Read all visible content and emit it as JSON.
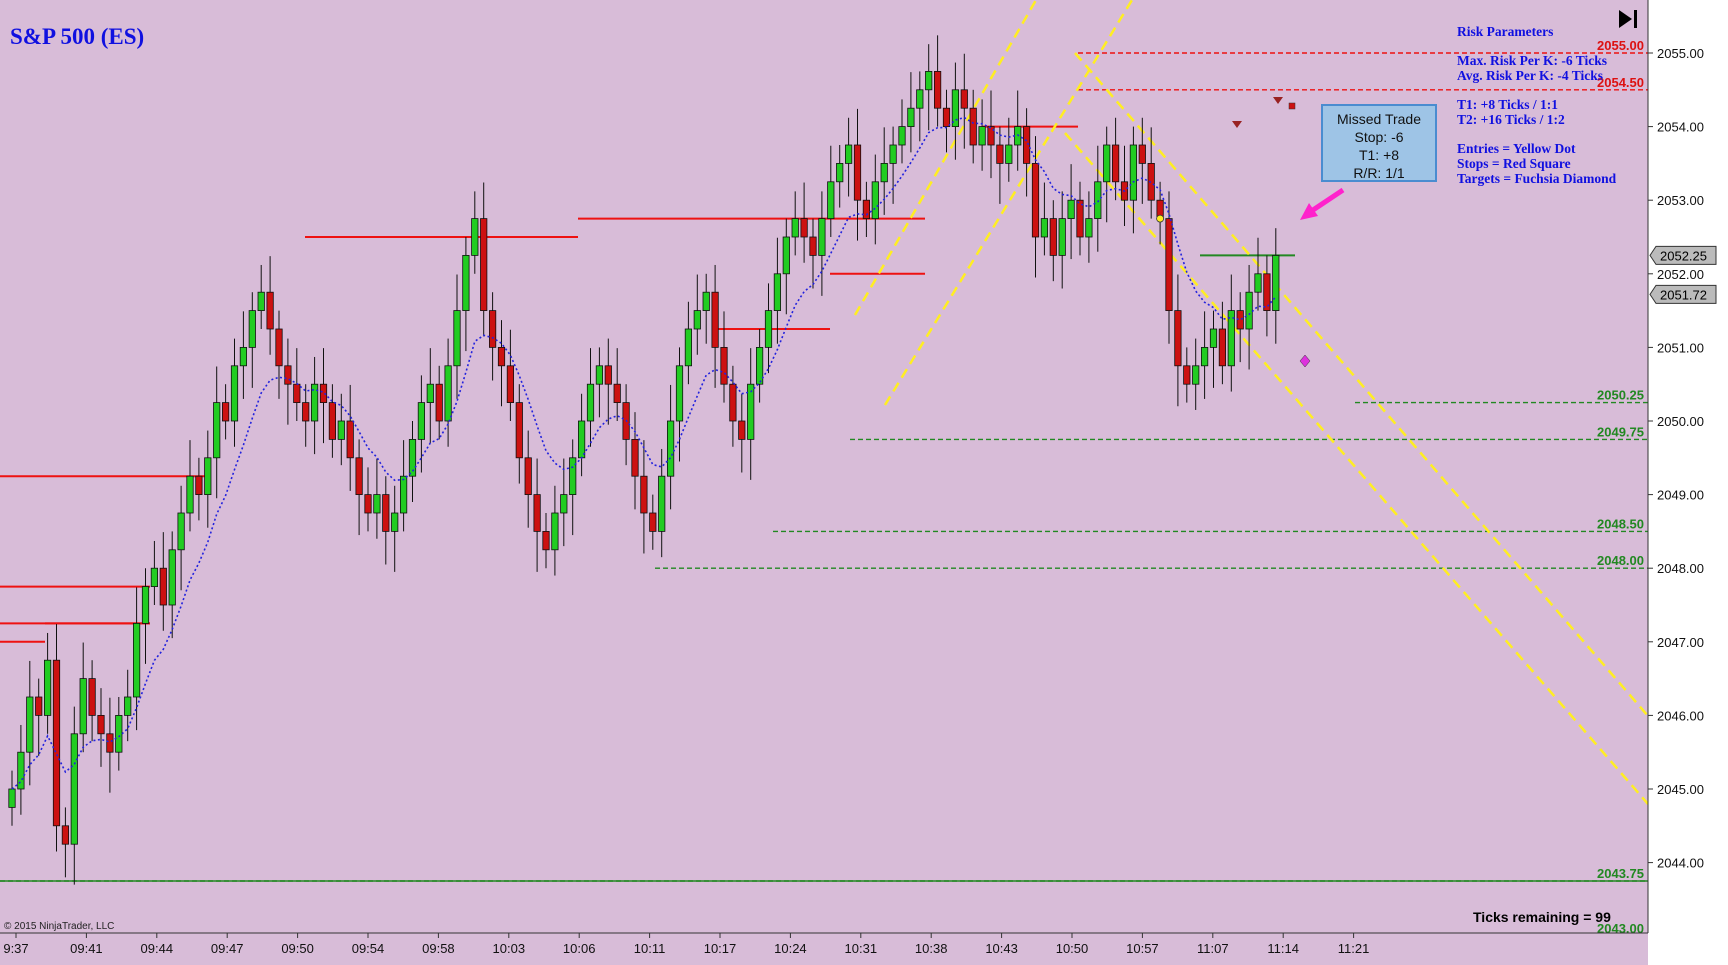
{
  "header": {
    "title": "S&P 500 (ES)"
  },
  "risk_panel": {
    "title": "Risk Parameters",
    "max_risk": "Max. Risk Per K:  -6 Ticks",
    "avg_risk": "Avg. Risk Per K:  -4 Ticks",
    "t1": "T1:  +8 Ticks  /  1:1",
    "t2": "T2:  +16 Ticks  /  1:2",
    "entries": "Entries = Yellow Dot",
    "stops": "Stops = Red Square",
    "targets": "Targets = Fuchsia Diamond"
  },
  "missed_trade": {
    "title": "Missed Trade",
    "stop": "Stop:  -6",
    "t1": "T1:  +8",
    "rr": "R/R:  1/1"
  },
  "footer": {
    "copyright": "© 2015 NinjaTrader, LLC",
    "ticks_remaining": "Ticks remaining = 99"
  },
  "colors": {
    "background": "#d8bcd8",
    "up_candle": "#22cc22",
    "down_candle": "#cc1111",
    "resistance": "#ee1111",
    "support": "#228822",
    "channel": "#ffee22",
    "ma": "#2222dd",
    "title": "#1010e0"
  },
  "icons": {
    "end_button": "skip-to-end-icon",
    "missed_arrow": "arrow-icon"
  },
  "chart_data": {
    "type": "candlestick",
    "instrument": "S&P 500 (ES)",
    "ylim": [
      2043.0,
      2055.5
    ],
    "y_ticks": [
      "2055.00",
      "2054.00",
      "2053.00",
      "2052.00",
      "2051.00",
      "2050.00",
      "2049.00",
      "2048.00",
      "2047.00",
      "2046.00",
      "2045.00",
      "2044.00"
    ],
    "x_ticks": [
      "9:37",
      "09:41",
      "09:44",
      "09:47",
      "09:50",
      "09:54",
      "09:58",
      "10:03",
      "10:06",
      "10:11",
      "10:17",
      "10:24",
      "10:31",
      "10:38",
      "10:43",
      "10:50",
      "10:57",
      "11:07",
      "11:14",
      "11:21"
    ],
    "price_markers": [
      {
        "label": "2052.25",
        "value": 2052.25
      },
      {
        "label": "2051.72",
        "value": 2051.72
      }
    ],
    "level_labels": [
      {
        "label": "2055.00",
        "value": 2055.0,
        "kind": "resistance"
      },
      {
        "label": "2054.50",
        "value": 2054.5,
        "kind": "resistance"
      },
      {
        "label": "2050.25",
        "value": 2050.25,
        "kind": "support"
      },
      {
        "label": "2049.75",
        "value": 2049.75,
        "kind": "support"
      },
      {
        "label": "2048.50",
        "value": 2048.5,
        "kind": "support"
      },
      {
        "label": "2048.00",
        "value": 2048.0,
        "kind": "support"
      },
      {
        "label": "2043.75",
        "value": 2043.75,
        "kind": "support"
      },
      {
        "label": "2043.00",
        "value": 2043.0,
        "kind": "support"
      }
    ],
    "closes": [
      2045.0,
      2045.5,
      2046.25,
      2046.0,
      2046.75,
      2044.5,
      2044.25,
      2045.75,
      2046.5,
      2046.0,
      2045.75,
      2045.5,
      2046.0,
      2046.25,
      2047.25,
      2047.75,
      2048.0,
      2047.5,
      2048.25,
      2048.75,
      2049.25,
      2049.0,
      2049.5,
      2050.25,
      2050.0,
      2050.75,
      2051.0,
      2051.5,
      2051.75,
      2051.25,
      2050.75,
      2050.5,
      2050.25,
      2050.0,
      2050.5,
      2050.25,
      2049.75,
      2050.0,
      2049.5,
      2049.0,
      2048.75,
      2049.0,
      2048.5,
      2048.75,
      2049.25,
      2049.75,
      2050.25,
      2050.5,
      2050.0,
      2050.75,
      2051.5,
      2052.25,
      2052.75,
      2051.5,
      2051.0,
      2050.75,
      2050.25,
      2049.5,
      2049.0,
      2048.5,
      2048.25,
      2048.75,
      2049.0,
      2049.5,
      2050.0,
      2050.5,
      2050.75,
      2050.5,
      2050.25,
      2049.75,
      2049.25,
      2048.75,
      2048.5,
      2049.25,
      2050.0,
      2050.75,
      2051.25,
      2051.5,
      2051.75,
      2051.0,
      2050.5,
      2050.0,
      2049.75,
      2050.5,
      2051.0,
      2051.5,
      2052.0,
      2052.5,
      2052.75,
      2052.5,
      2052.25,
      2052.75,
      2053.25,
      2053.5,
      2053.75,
      2053.0,
      2052.75,
      2053.25,
      2053.5,
      2053.75,
      2054.0,
      2054.25,
      2054.5,
      2054.75,
      2054.25,
      2054.0,
      2054.5,
      2054.25,
      2053.75,
      2054.0,
      2053.75,
      2053.5,
      2053.75,
      2054.0,
      2053.5,
      2052.5,
      2052.75,
      2052.25,
      2052.75,
      2053.0,
      2052.5,
      2052.75,
      2053.25,
      2053.75,
      2053.25,
      2053.0,
      2053.75,
      2053.5,
      2053.0,
      2052.75,
      2051.5,
      2050.75,
      2050.5,
      2050.75,
      2051.0,
      2051.25,
      2050.75,
      2051.5,
      2051.25,
      2051.75,
      2052.0,
      2051.5,
      2052.25
    ]
  }
}
